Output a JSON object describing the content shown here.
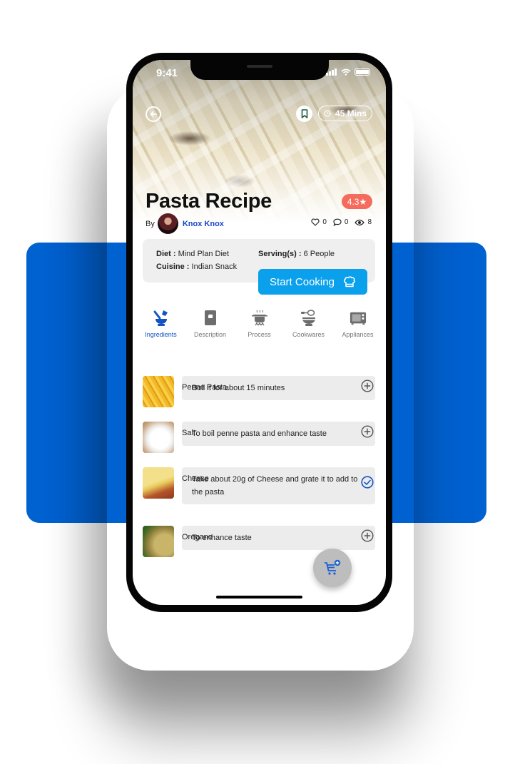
{
  "status_bar": {
    "time": "9:41"
  },
  "header": {
    "cook_time": "45 Mins"
  },
  "recipe": {
    "title": "Pasta Recipe",
    "rating": "4.3★",
    "by_label": "By",
    "author": "Knox Knox",
    "likes": "0",
    "comments": "0",
    "views": "8"
  },
  "info": {
    "diet_label": "Diet :",
    "diet_value": "Mind Plan Diet",
    "servings_label": "Serving(s) :",
    "servings_value": "6 People",
    "cuisine_label": "Cuisine :",
    "cuisine_value": "Indian Snack",
    "start_button": "Start Cooking"
  },
  "tabs": [
    {
      "label": "Ingredients",
      "icon": "mortar-pestle-icon",
      "active": true
    },
    {
      "label": "Description",
      "icon": "book-icon",
      "active": false
    },
    {
      "label": "Process",
      "icon": "cooking-pot-icon",
      "active": false
    },
    {
      "label": "Cookwares",
      "icon": "mixer-bowl-icon",
      "active": false
    },
    {
      "label": "Appliances",
      "icon": "microwave-icon",
      "active": false
    }
  ],
  "ingredients": [
    {
      "name": "Penne Pasta",
      "note": "Boil it for about 15 minutes",
      "state": "add"
    },
    {
      "name": "Salt",
      "note": "To boil penne pasta and enhance taste",
      "state": "add"
    },
    {
      "name": "Cheese",
      "note": "Take about 20g of Cheese and grate it to add to the pasta",
      "state": "added"
    },
    {
      "name": "Oregano",
      "note": "To enhance taste",
      "state": "add"
    }
  ],
  "colors": {
    "brand_blue": "#0061d1",
    "start_button": "#0aa0ec",
    "rating_badge": "#f56b5c",
    "active_tab": "#1553c4"
  }
}
